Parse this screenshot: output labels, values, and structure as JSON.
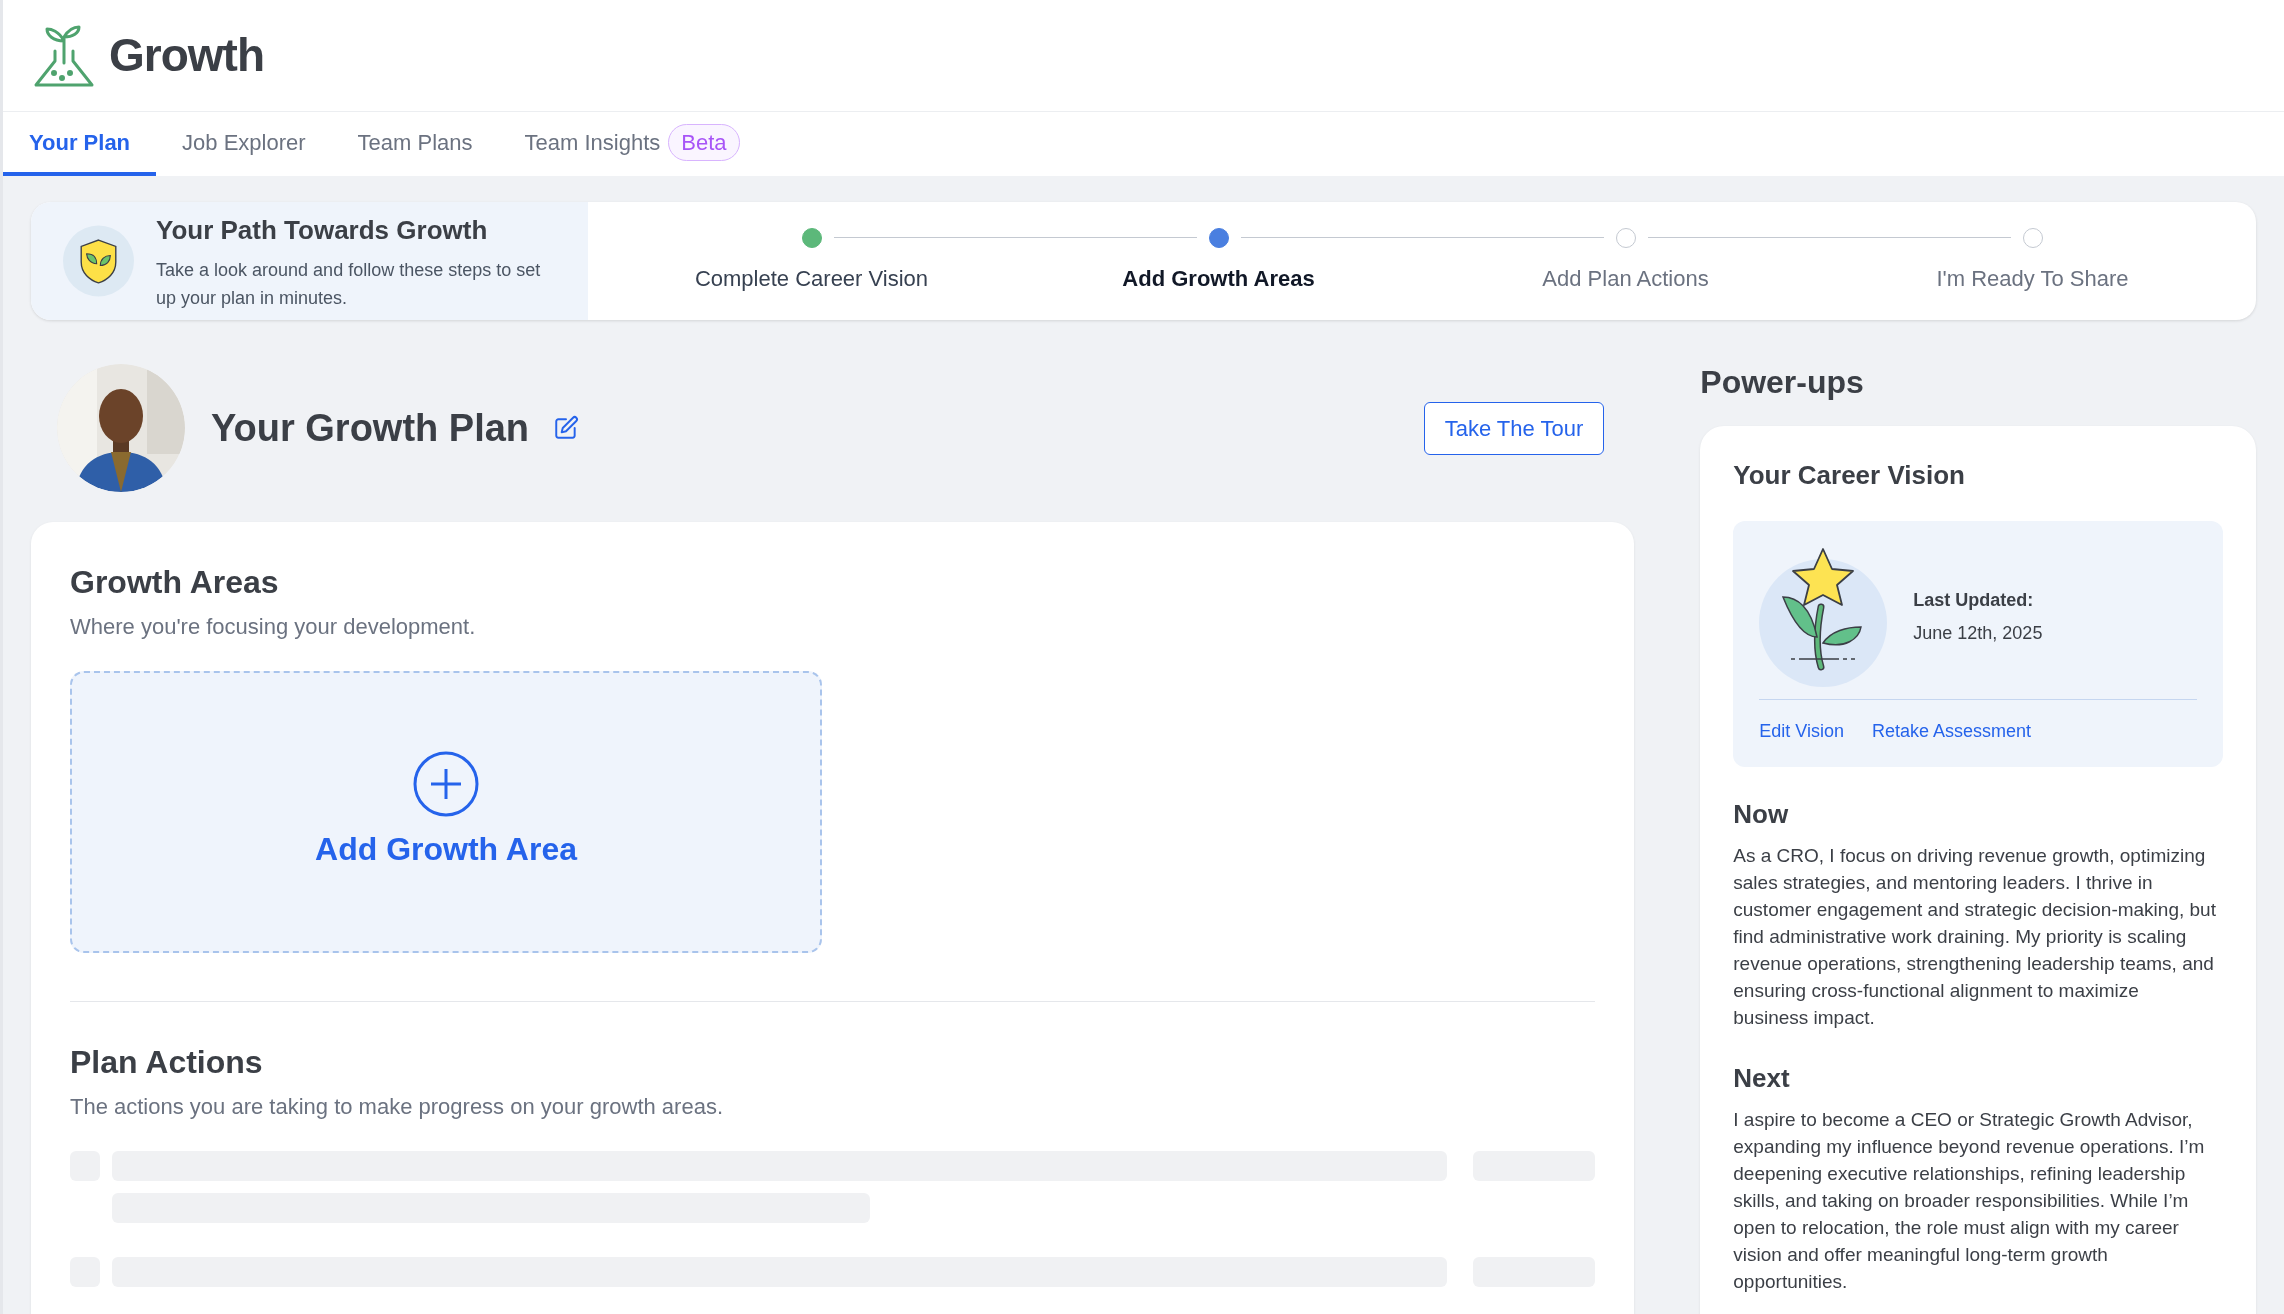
{
  "app": {
    "name": "Growth"
  },
  "tabs": [
    {
      "label": "Your Plan",
      "selected": true
    },
    {
      "label": "Job Explorer",
      "selected": false
    },
    {
      "label": "Team Plans",
      "selected": false
    },
    {
      "label": "Team Insights",
      "badge": "Beta",
      "selected": false
    }
  ],
  "onboarding": {
    "title": "Your Path Towards Growth",
    "text": "Take a look around and follow these steps to set up your plan in minutes.",
    "steps": [
      {
        "label": "Complete Career Vision",
        "completed": true,
        "selected": false
      },
      {
        "label": "Add Growth Areas",
        "completed": false,
        "selected": true
      },
      {
        "label": "Add Plan Actions",
        "completed": false,
        "selected": false
      },
      {
        "label": "I'm Ready To Share",
        "completed": false,
        "selected": false
      }
    ]
  },
  "plan": {
    "title": "Your Growth Plan",
    "tour_button": "Take The Tour"
  },
  "growth_areas": {
    "title": "Growth Areas",
    "subtitle": "Where you're focusing your development.",
    "add_button": "Add Growth Area"
  },
  "plan_actions": {
    "title": "Plan Actions",
    "subtitle": "The actions you are taking to make progress on your growth areas."
  },
  "power_ups": {
    "title": "Power-ups",
    "card": {
      "title": "Your Career Vision",
      "last_updated_label": "Last Updated:",
      "last_updated": "June 12th, 2025",
      "links": [
        "Edit Vision",
        "Retake Assessment"
      ],
      "sections": [
        {
          "heading": "Now",
          "text": "As a CRO, I focus on driving revenue growth, optimizing sales strategies, and mentoring leaders. I thrive in customer engagement and strategic decision-making, but find administrative work draining. My priority is scaling revenue operations, strengthening leadership teams, and ensuring cross-functional alignment to maximize business impact."
        },
        {
          "heading": "Next",
          "text": "I aspire to become a CEO or Strategic Growth Advisor, expanding my influence beyond revenue operations. I’m deepening executive relationships, refining leadership skills, and taking on broader responsibilities. While I’m open to relocation, the role must align with my career vision and offer meaningful long-term growth opportunities."
        }
      ]
    }
  }
}
